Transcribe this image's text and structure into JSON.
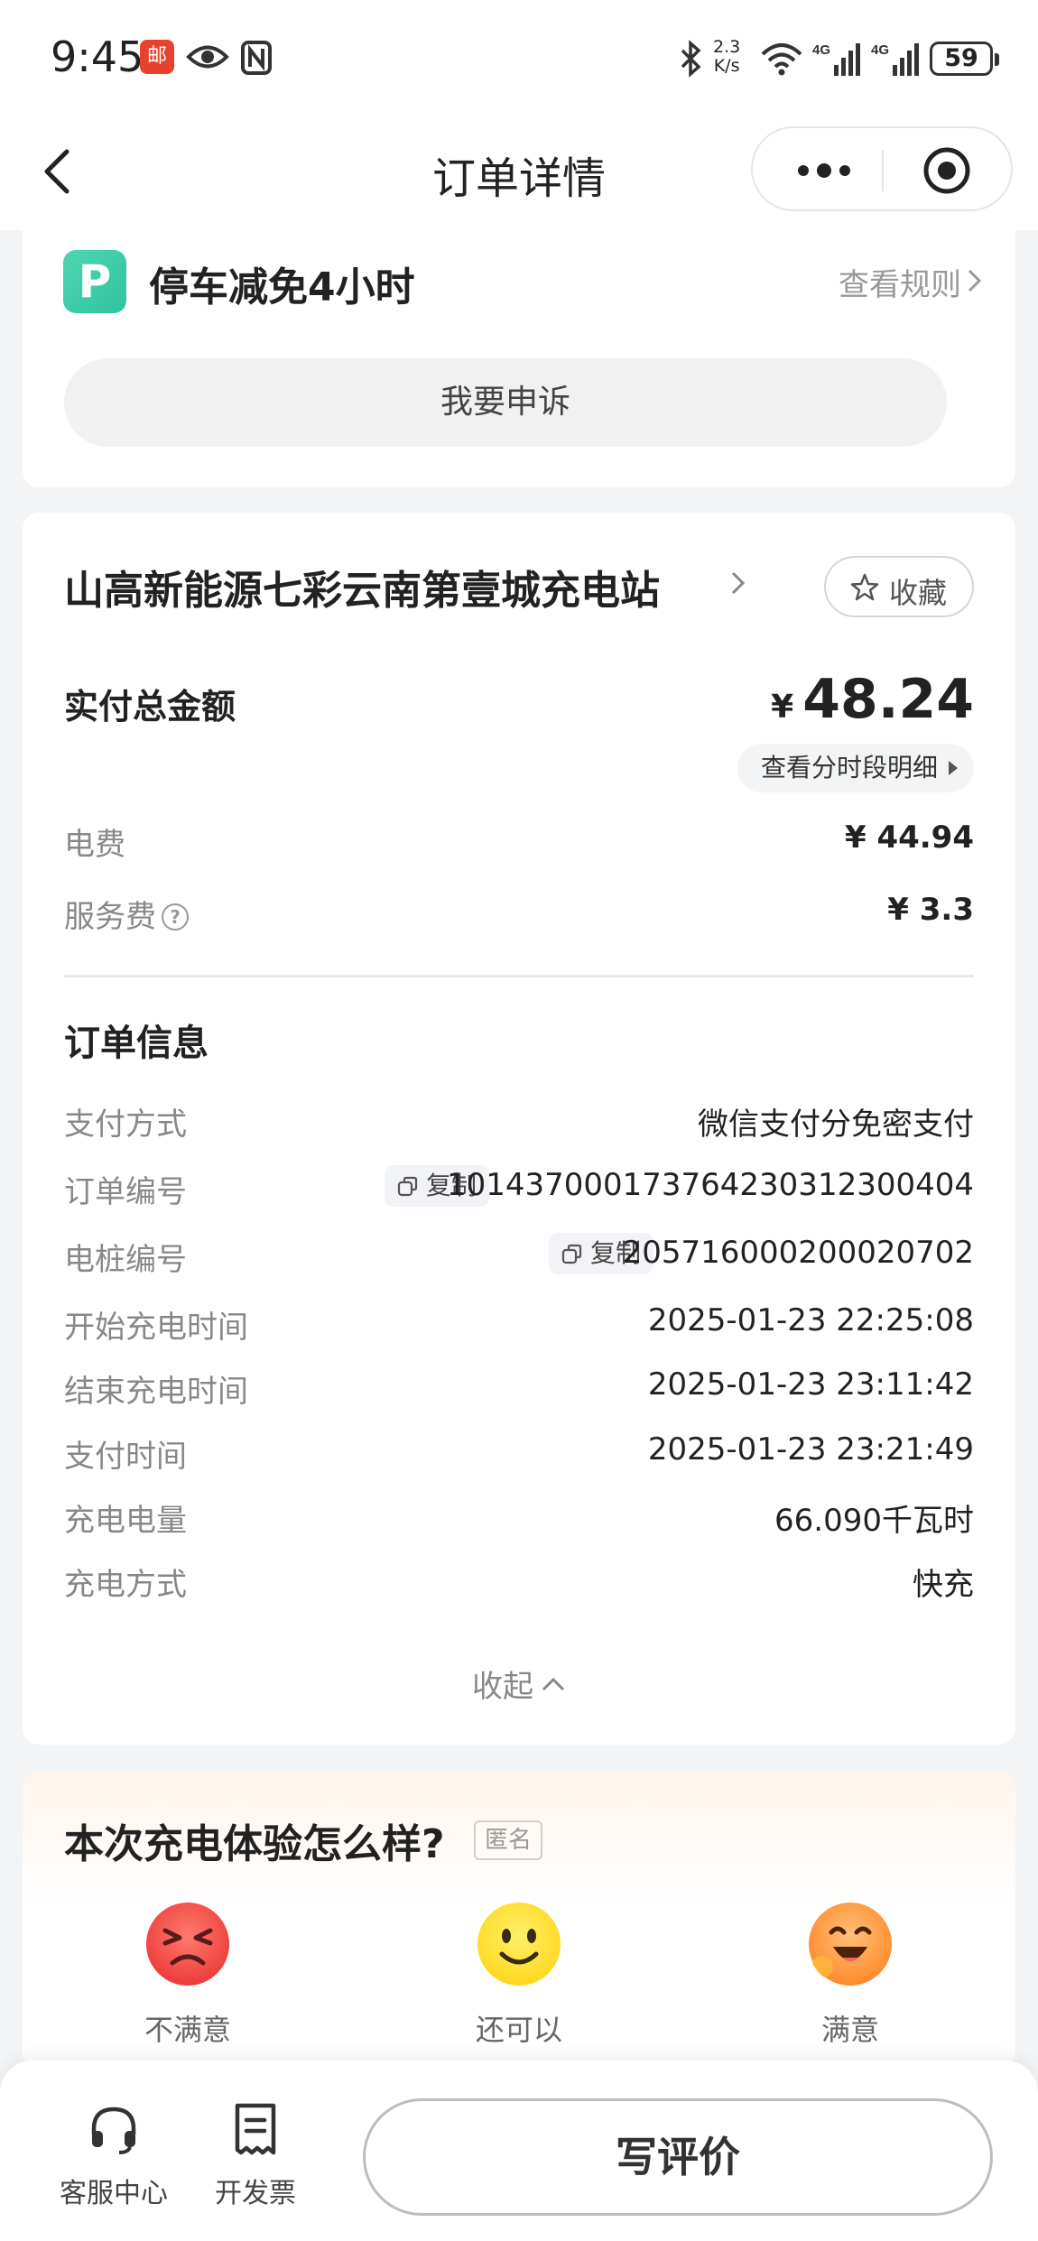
{
  "status_bar": {
    "time": "9:45",
    "app_icon_label": "邮",
    "speed_top": "2.3",
    "speed_bottom": "K/s",
    "network_1": "4G",
    "network_2": "4G",
    "battery": "59"
  },
  "nav": {
    "title": "订单详情"
  },
  "parking": {
    "icon_letter": "P",
    "title": "停车减免4小时",
    "rules_link": "查看规则",
    "appeal_button": "我要申诉"
  },
  "station": {
    "name": "山高新能源七彩云南第壹城充电站",
    "favorite_label": "收藏",
    "total_label": "实付总金额",
    "currency": "¥",
    "total_amount": "48.24",
    "detail_link": "查看分时段明细",
    "fees": [
      {
        "label": "电费",
        "value": "¥ 44.94"
      },
      {
        "label": "服务费",
        "value": "¥ 3.3"
      }
    ],
    "help_icon_glyph": "?"
  },
  "order_info": {
    "section_title": "订单信息",
    "copy_label": "复制",
    "rows": [
      {
        "label": "支付方式",
        "value": "微信支付分免密支付"
      },
      {
        "label": "订单编号",
        "value": "1014370001737642303123004​04"
      },
      {
        "label": "电桩编号",
        "value": "205716000200020702"
      },
      {
        "label": "开始充电时间",
        "value": "2025-01-23 22:25:08"
      },
      {
        "label": "结束充电时间",
        "value": "2025-01-23 23:11:42"
      },
      {
        "label": "支付时间",
        "value": "2025-01-23 23:21:49"
      },
      {
        "label": "充电电量",
        "value": "66.090千瓦时"
      },
      {
        "label": "充电方式",
        "value": "快充"
      }
    ],
    "collapse_label": "收起"
  },
  "rating": {
    "title": "本次充电体验怎么样?",
    "anonymous_tag": "匿名",
    "options": [
      {
        "label": "不满意",
        "color": "#f2504b"
      },
      {
        "label": "还可以",
        "color": "#ffe23a"
      },
      {
        "label": "满意",
        "color": "#ff9a3c"
      }
    ]
  },
  "bottom_bar": {
    "service_label": "客服中心",
    "invoice_label": "开发票",
    "review_button": "写评价"
  }
}
